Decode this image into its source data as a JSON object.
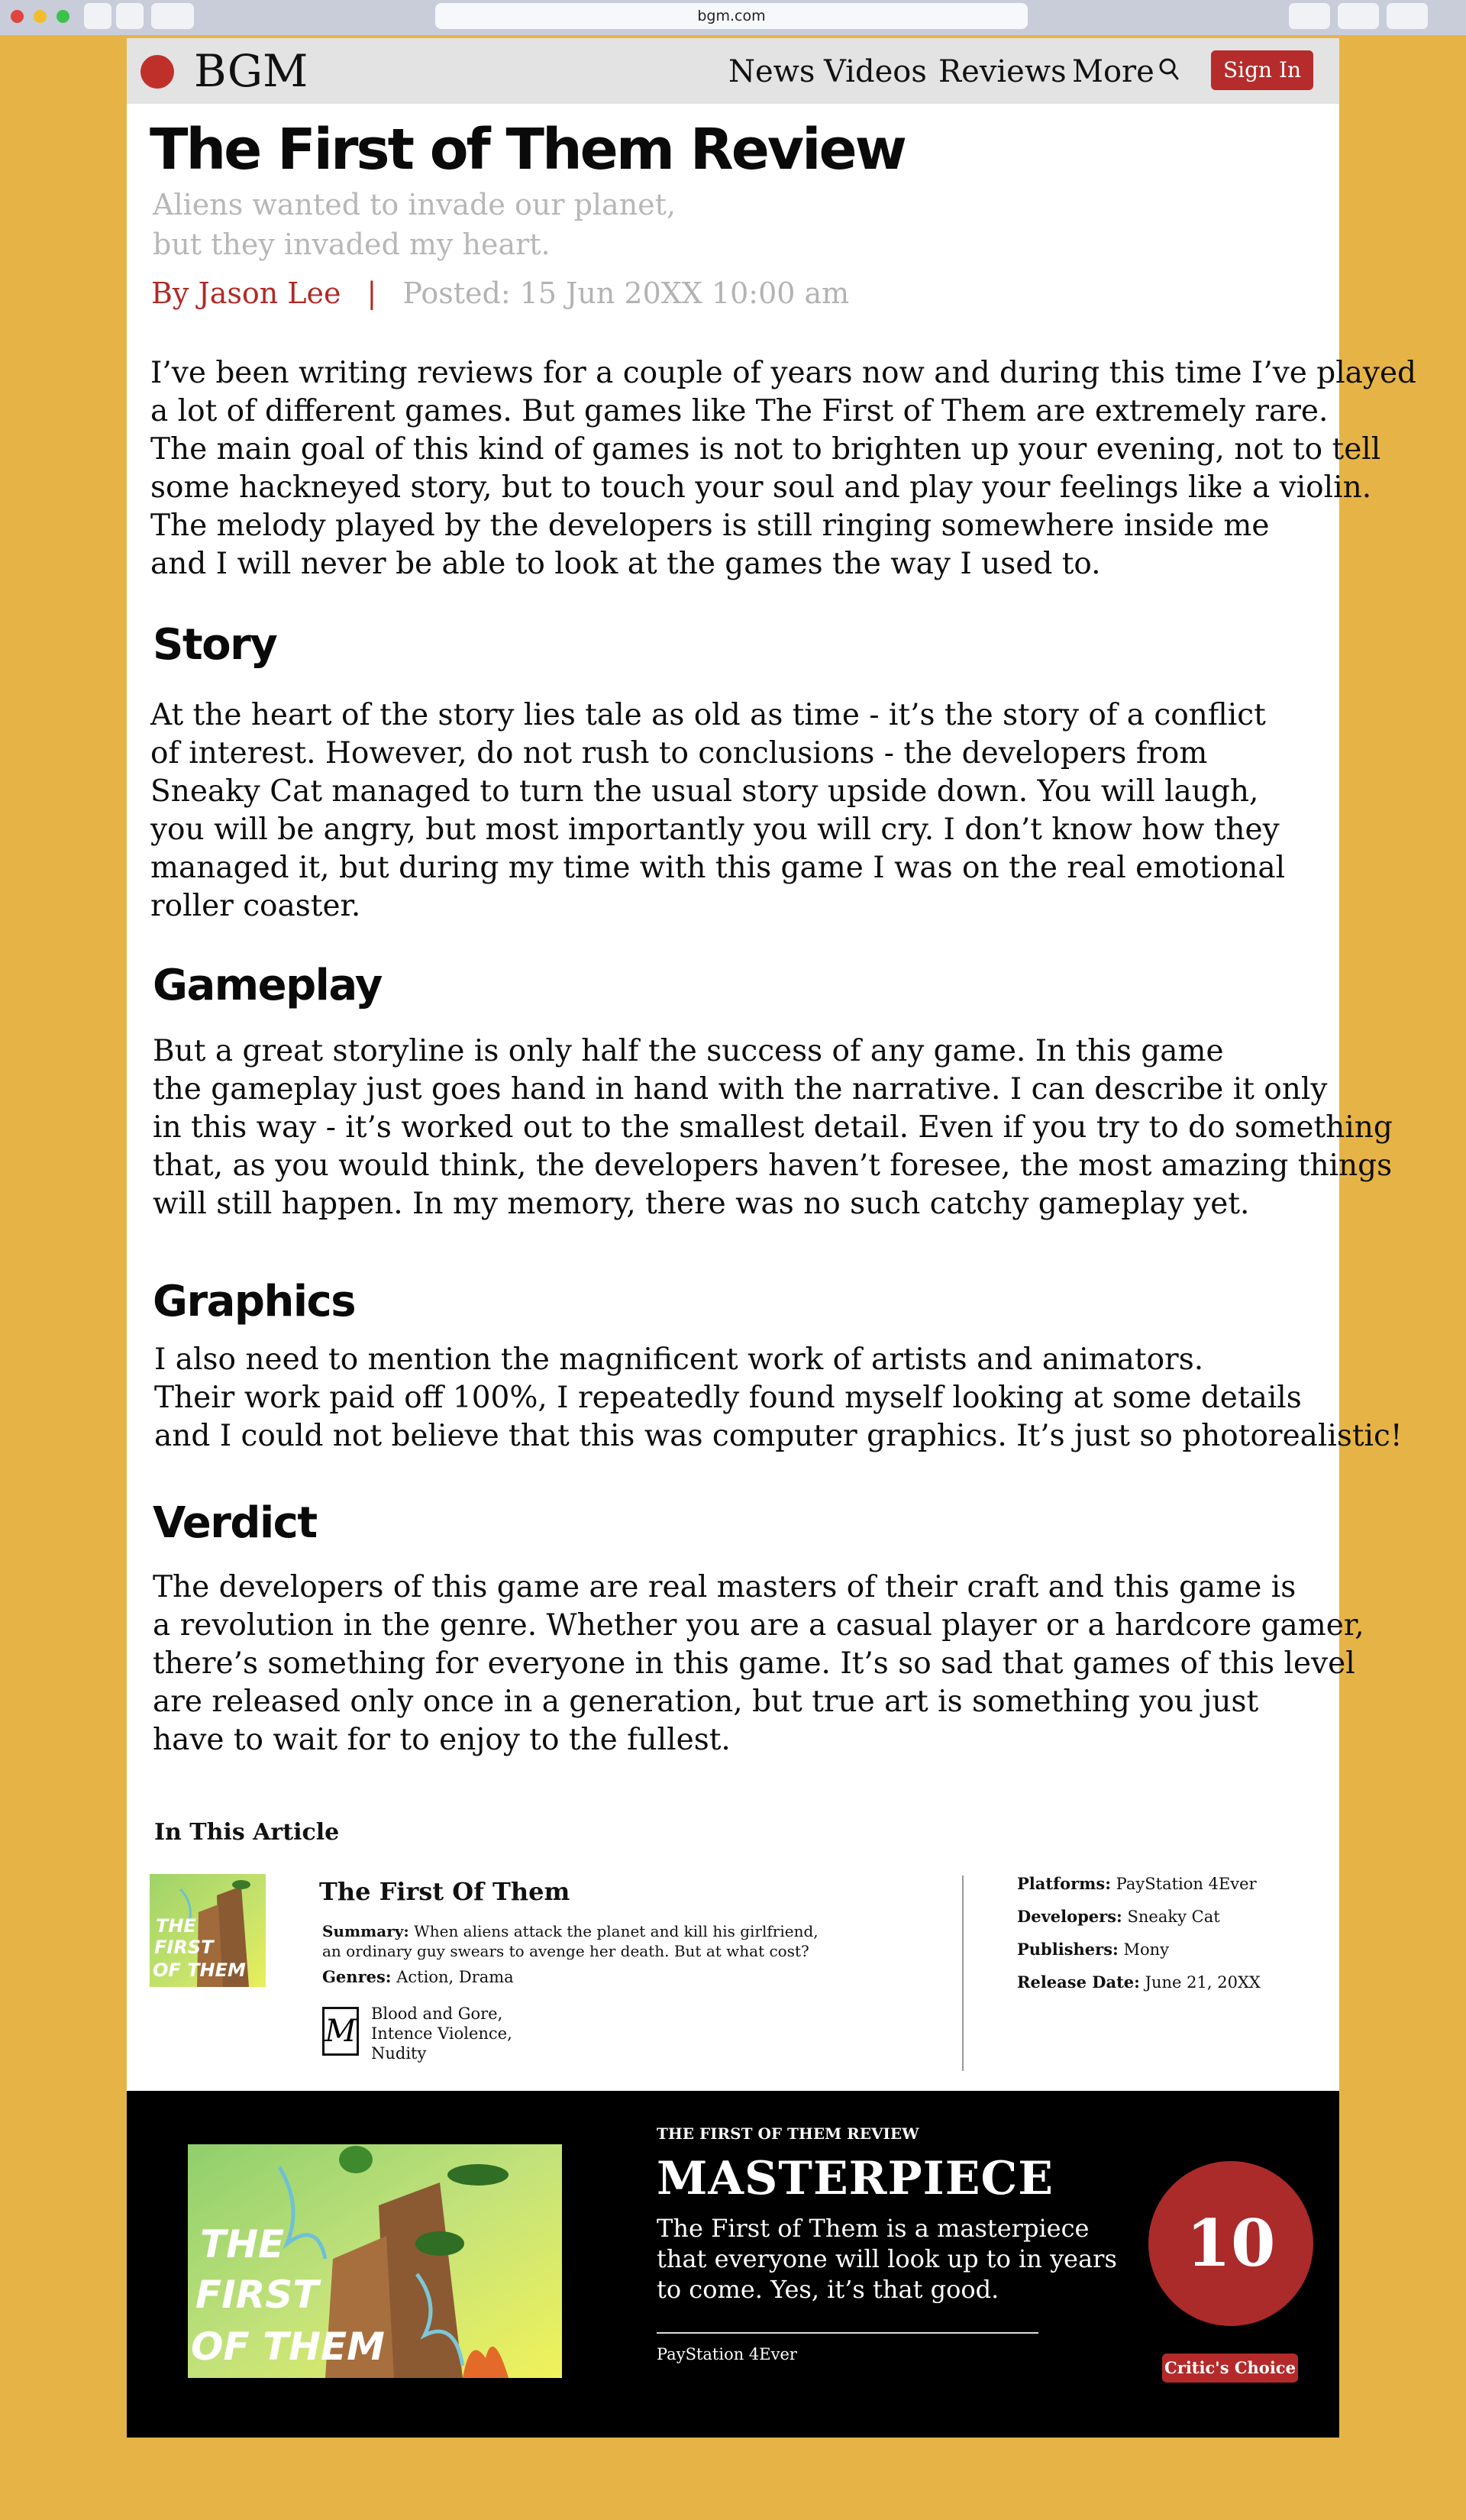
{
  "browser": {
    "url": "bgm.com"
  },
  "nav": {
    "logo": "BGM",
    "items": [
      "News",
      "Videos",
      "Reviews",
      "More"
    ],
    "signin": "Sign In"
  },
  "article": {
    "title": "The First of Them Review",
    "subtitle": [
      "Aliens wanted to invade our planet,",
      "but they invaded my heart."
    ],
    "author": "By Jason Lee",
    "separator": "|",
    "posted": "Posted: 15 Jun 20XX 10:00 am",
    "intro": [
      "I’ve been writing reviews for a couple of years now and during this time I’ve played",
      "a lot of different games. But games like The First of Them are extremely rare.",
      "The main goal of this kind of games is not to brighten up your evening, not to tell",
      "some hackneyed story, but to touch your soul and play your feelings like a violin.",
      "The melody played by the developers is still ringing somewhere inside me",
      "and I will never be able to look at the games the way I used to."
    ],
    "sections": [
      {
        "heading": "Story",
        "lines": [
          "At the heart of the story lies tale as old as time - it’s the story of a conflict",
          "of interest. However, do not rush to conclusions - the developers from",
          "Sneaky Cat managed to turn the usual story upside down. You will laugh,",
          "you will be angry, but most importantly you will cry. I don’t know how they",
          "managed it, but during my time with this game I was on the real emotional",
          "roller coaster."
        ]
      },
      {
        "heading": "Gameplay",
        "lines": [
          "But a great storyline is only half the success of any game. In this game",
          "the gameplay just goes hand in hand with the narrative. I can describe it only",
          "in this way - it’s worked out to the smallest detail. Even if you try to do something",
          "that, as you would think, the developers haven’t foresee, the most amazing things",
          "will still happen. In my memory, there was no such catchy gameplay yet."
        ]
      },
      {
        "heading": "Graphics",
        "lines": [
          "I also need to mention the magnificent work of artists and animators.",
          "Their work paid off 100%, I repeatedly found myself looking at some details",
          "and I could not believe that this was computer graphics. It’s just so photorealistic!"
        ]
      },
      {
        "heading": "Verdict",
        "lines": [
          "The developers of this game are real masters of their craft and this game is",
          "a revolution in the genre. Whether you are a casual player or a hardcore gamer,",
          "there’s something for everyone in this game. It’s so sad that games of this level",
          "are released only once in a generation, but true art is something you just",
          "have to wait for to enjoy to the fullest."
        ]
      }
    ]
  },
  "in_article": {
    "label": "In This Article",
    "cover_text": [
      "THE",
      "FIRST",
      "OF THEM"
    ],
    "game_title": "The First Of Them",
    "summary_label": "Summary:",
    "summary": [
      "When aliens attack the planet and kill his girlfriend,",
      "an ordinary guy swears to avenge her death. But at what cost?"
    ],
    "genres_label": "Genres:",
    "genres": "Action, Drama",
    "rating_letter": "M",
    "rating_descriptors": [
      "Blood and Gore,",
      "Intence Violence,",
      "Nudity"
    ],
    "details": [
      {
        "label": "Platforms:",
        "value": "PayStation 4Ever"
      },
      {
        "label": "Developers:",
        "value": "Sneaky Cat"
      },
      {
        "label": "Publishers:",
        "value": "Mony"
      },
      {
        "label": "Release Date:",
        "value": "June 21, 20XX"
      }
    ]
  },
  "verdict_banner": {
    "cover_text": [
      "THE",
      "FIRST",
      "OF THEM"
    ],
    "kicker": "THE FIRST OF THEM REVIEW",
    "verdict": "MASTERPIECE",
    "text": [
      "The First of Them is a masterpiece",
      "that everyone will look up to in years",
      "to come. Yes, it’s that good."
    ],
    "platform": "PayStation 4Ever",
    "score": "10",
    "badge": "Critic's Choice"
  }
}
